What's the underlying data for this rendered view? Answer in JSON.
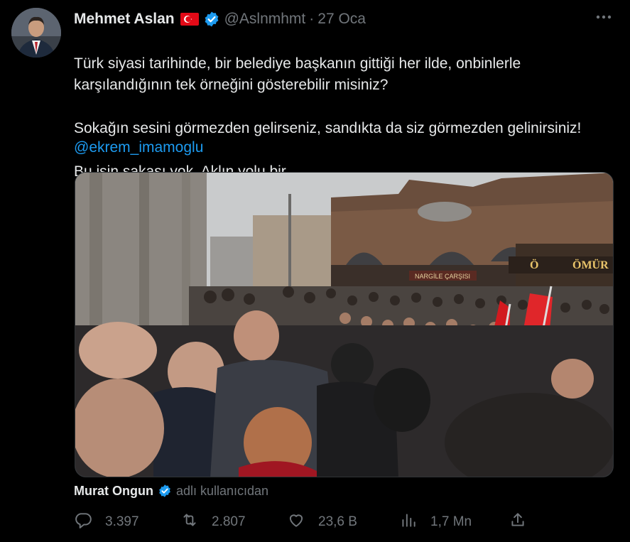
{
  "author": {
    "name": "Mehmet Aslan",
    "handle": "@Aslnmhmt",
    "separator": "·",
    "date": "27 Oca"
  },
  "tweet": {
    "lines": [
      "Türk siyasi tarihinde, bir belediye başkanın gittiği her ilde, onbinlerle karşılandığının tek örneğini gösterebilir misiniz?",
      "Sokağın sesini görmezden gelirseniz, sandıkta da siz görmezden gelinirsiniz!",
      "Bu işin şakası yok. Aklın yolu bir."
    ],
    "mention": "@ekrem_imamoglu"
  },
  "media": {
    "sign_left": "Ö",
    "sign_right": "ÖMÜR",
    "shop_sign": "NARGİLE ÇARŞISI"
  },
  "attribution": {
    "name": "Murat Ongun",
    "text": "adlı kullanıcıdan"
  },
  "actions": {
    "reply": "3.397",
    "retweet": "2.807",
    "like": "23,6 B",
    "views": "1,7 Mn"
  },
  "colors": {
    "background": "#000000",
    "text": "#e7e9ea",
    "muted": "#71767b",
    "link": "#1d9bf0",
    "verified": "#1d9bf0",
    "flag_red": "#e30a17"
  }
}
